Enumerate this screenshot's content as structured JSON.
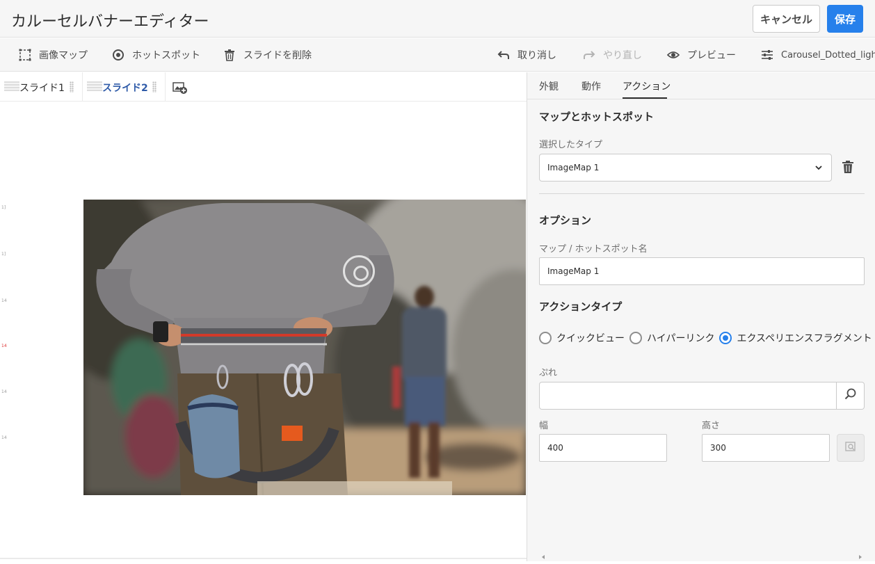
{
  "app": {
    "title": "カルーセルバナーエディター",
    "cancel_label": "キャンセル",
    "save_label": "保存",
    "accent_color": "#2680eb"
  },
  "toolbar": {
    "left": [
      {
        "label": "画像マップ",
        "icon": "image-map-icon"
      },
      {
        "label": "ホットスポット",
        "icon": "hotspot-icon"
      },
      {
        "label": "スライドを削除",
        "icon": "trash-icon"
      }
    ],
    "right": [
      {
        "label": "取り消し",
        "icon": "undo-icon",
        "enabled": true
      },
      {
        "label": "やり直し",
        "icon": "redo-icon",
        "enabled": false
      },
      {
        "label": "プレビュー",
        "icon": "eye-icon",
        "enabled": true
      },
      {
        "label": "Carousel_Dotted_light",
        "icon": "preset-sliders-icon",
        "enabled": true
      }
    ]
  },
  "slides": {
    "tabs": [
      {
        "label": "スライド1",
        "active": false
      },
      {
        "label": "スライド2",
        "active": true
      }
    ],
    "add_icon": "add-slide-icon"
  },
  "canvas": {
    "ruler_marks": [
      "1]",
      "1]",
      "14",
      "14",
      "14",
      "14"
    ]
  },
  "panel": {
    "tabs": [
      {
        "label": "外観"
      },
      {
        "label": "動作"
      },
      {
        "label": "アクション",
        "active": true
      }
    ],
    "map_section_title": "マップとホットスポット",
    "selected_type_label": "選択したタイプ",
    "selected_type_value": "ImageMap 1",
    "options_title": "オプション",
    "name_label": "マップ / ホットスポット名",
    "name_value": "ImageMap 1",
    "action_type_title": "アクションタイプ",
    "action_types": [
      {
        "label": "クイックビュー",
        "selected": false
      },
      {
        "label": "ハイパーリンク",
        "selected": false
      },
      {
        "label": "エクスペリエンスフラグメント",
        "selected": true
      }
    ],
    "fragment_label": "ぷれ",
    "fragment_value": "",
    "width_label": "幅",
    "width_value": "400",
    "height_label": "高さ",
    "height_value": "300"
  }
}
